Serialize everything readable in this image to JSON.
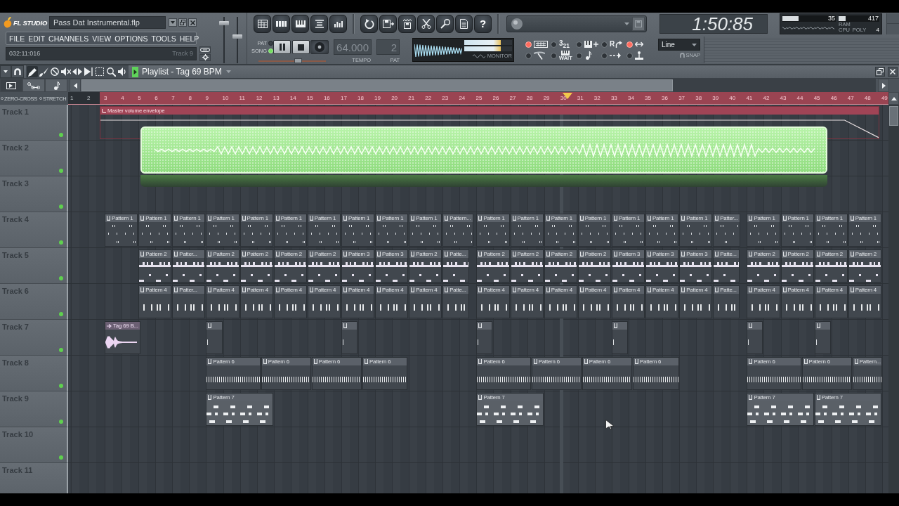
{
  "title_bar": {
    "logo": "FL STUDIO",
    "file_name": "Pass Dat Instrumental.flp"
  },
  "menu": [
    "FILE",
    "EDIT",
    "CHANNELS",
    "VIEW",
    "OPTIONS",
    "TOOLS",
    "HELP"
  ],
  "hint_bar": {
    "position": "032:11:016",
    "track": "Track 9"
  },
  "master_sliders": [
    {
      "level": 0.9
    },
    {
      "level": 0.58
    }
  ],
  "toolbar_groups": [
    [
      {
        "kind": "playlist"
      },
      {
        "kind": "step-sequencer"
      },
      {
        "kind": "piano-roll"
      },
      {
        "kind": "browser"
      },
      {
        "kind": "mixer"
      }
    ],
    [
      {
        "kind": "undo"
      },
      {
        "kind": "save-as"
      },
      {
        "kind": "export"
      },
      {
        "kind": "cut"
      },
      {
        "kind": "record"
      },
      {
        "kind": "info"
      },
      {
        "kind": "help",
        "label": "?"
      }
    ]
  ],
  "time_display": "1:50:85",
  "cpu_panel": {
    "cpu": {
      "reading": "35",
      "level": 0.3
    },
    "ram": {
      "reading": "417",
      "level": 0.18
    },
    "ram_label": "RAM",
    "cpu_label": "CPU",
    "poly_label": "POLY",
    "poly": "4"
  },
  "transport": {
    "modes": [
      {
        "label": "PAT",
        "selected": false
      },
      {
        "label": "SONG",
        "selected": true
      }
    ],
    "playing": true,
    "recording": false,
    "tempo": "64.000",
    "tempo_label": "TEMPO",
    "pattern": "2",
    "pattern_label": "PAT",
    "song_position": {
      "level": 0.6
    }
  },
  "monitor": {
    "label": "MONITOR",
    "meters": [
      {
        "level": 0.77
      },
      {
        "level": 0.77
      }
    ]
  },
  "toggles": [
    {
      "kind": "keyboard",
      "on": true
    },
    {
      "kind": "countdown",
      "label": "3$_{21}$",
      "on": false
    },
    {
      "kind": "piano-plus",
      "on": false
    },
    {
      "kind": "loop",
      "label": "R",
      "on": false
    },
    {
      "kind": "blend",
      "on": true
    },
    {
      "kind": "needle",
      "on": false
    },
    {
      "kind": "wait",
      "label": "WAIT",
      "on": false
    },
    {
      "kind": "note",
      "on": false
    },
    {
      "kind": "arrows",
      "on": false
    },
    {
      "kind": "joystick",
      "on": false
    }
  ],
  "snap": {
    "value": "Line",
    "label": "SNAP"
  },
  "playlist": {
    "title": "Playlist - Tag 69 BPM",
    "tools": [
      {
        "kind": "pencil",
        "selected": true
      },
      {
        "kind": "paint",
        "selected": false
      },
      {
        "kind": "delete",
        "selected": false
      },
      {
        "kind": "mute",
        "selected": false
      },
      {
        "kind": "slip",
        "selected": false
      },
      {
        "kind": "slice",
        "selected": false
      },
      {
        "kind": "select",
        "selected": false
      },
      {
        "kind": "zoom",
        "selected": false
      },
      {
        "kind": "playback",
        "selected": false
      }
    ],
    "view_tabs": [
      {
        "kind": "pattern",
        "selected": true
      },
      {
        "kind": "automation",
        "selected": false
      },
      {
        "kind": "note",
        "selected": false
      }
    ],
    "ruler_options": [
      {
        "label": "ZERO-CROSS",
        "on": false
      },
      {
        "label": "STRETCH",
        "on": false
      }
    ],
    "ruler": [
      "1",
      "2",
      "3",
      "4",
      "5",
      "6",
      "7",
      "8",
      "9",
      "10",
      "11",
      "12",
      "13",
      "14",
      "15",
      "16",
      "17",
      "18",
      "19",
      "20",
      "21",
      "22",
      "23",
      "24",
      "25",
      "26",
      "27",
      "28",
      "29",
      "30",
      "31",
      "32",
      "33",
      "34",
      "35",
      "36",
      "37",
      "38",
      "39",
      "40",
      "41",
      "42",
      "43",
      "44",
      "45",
      "46",
      "47",
      "48",
      "49"
    ],
    "tracks": [
      {
        "name": "Track 1",
        "muted": false,
        "clips": [
          {
            "kind": "automation",
            "label": "Master volume envelope"
          }
        ]
      },
      {
        "name": "Track 2",
        "muted": false
      },
      {
        "name": "Track 3",
        "muted": false
      },
      {
        "name": "Track 4",
        "muted": false,
        "clips": [
          {
            "label": "Pattern 1"
          },
          {
            "label": "Pattern 1"
          },
          {
            "label": "Pattern 1"
          },
          {
            "label": "Pattern 1"
          },
          {
            "label": "Pattern 1"
          },
          {
            "label": "Pattern 1"
          },
          {
            "label": "Pattern 1"
          },
          {
            "label": "Pattern 1"
          },
          {
            "label": "Pattern 1"
          },
          {
            "label": "Pattern 1"
          },
          {
            "label": "Pattern..."
          },
          {
            "label": "Pattern 1"
          },
          {
            "label": "Pattern 1"
          },
          {
            "label": "Pattern 1"
          },
          {
            "label": "Pattern 1"
          },
          {
            "label": "Pattern 1"
          },
          {
            "label": "Pattern 1"
          },
          {
            "label": "Pattern 1"
          },
          {
            "label": "Patter..."
          },
          {
            "label": "Pattern 1"
          },
          {
            "label": "Pattern 1"
          },
          {
            "label": "Pattern 1"
          },
          {
            "label": "Pattern 1"
          }
        ]
      },
      {
        "name": "Track 5",
        "muted": false,
        "clips": [
          {
            "label": "Pattern 2"
          },
          {
            "label": "Patter..."
          },
          {
            "label": "Pattern 2"
          },
          {
            "label": "Pattern 2"
          },
          {
            "label": "Pattern 2"
          },
          {
            "label": "Pattern 2"
          },
          {
            "label": "Pattern 3"
          },
          {
            "label": "Pattern 3"
          },
          {
            "label": "Pattern 2"
          },
          {
            "label": "Patte..."
          },
          {
            "label": "Pattern 2"
          },
          {
            "label": "Pattern 2"
          },
          {
            "label": "Pattern 2"
          },
          {
            "label": "Pattern 2"
          },
          {
            "label": "Pattern 3"
          },
          {
            "label": "Pattern 3"
          },
          {
            "label": "Pattern 3"
          },
          {
            "label": "Patte..."
          },
          {
            "label": "Pattern 2"
          },
          {
            "label": "Pattern 2"
          },
          {
            "label": "Pattern 2"
          },
          {
            "label": "Pattern 2"
          }
        ]
      },
      {
        "name": "Track 6",
        "muted": false,
        "clips": [
          {
            "label": "Pattern 4"
          },
          {
            "label": "Patter..."
          },
          {
            "label": "Pattern 4"
          },
          {
            "label": "Pattern 4"
          },
          {
            "label": "Pattern 4"
          },
          {
            "label": "Pattern 4"
          },
          {
            "label": "Pattern 4"
          },
          {
            "label": "Pattern 4"
          },
          {
            "label": "Pattern 4"
          },
          {
            "label": "Patte..."
          },
          {
            "label": "Pattern 4"
          },
          {
            "label": "Pattern 4"
          },
          {
            "label": "Pattern 4"
          },
          {
            "label": "Pattern 4"
          },
          {
            "label": "Pattern 4"
          },
          {
            "label": "Pattern 4"
          },
          {
            "label": "Pattern 4"
          },
          {
            "label": "Patte..."
          },
          {
            "label": "Pattern 4"
          },
          {
            "label": "Pattern 4"
          },
          {
            "label": "Pattern 4"
          },
          {
            "label": "Pattern 4"
          }
        ]
      },
      {
        "name": "Track 7",
        "muted": false,
        "clips": [
          {
            "kind": "audio",
            "label": "Tag 69 B..."
          },
          {
            "kind": "pattern"
          },
          {
            "kind": "pattern"
          },
          {
            "kind": "pattern"
          },
          {
            "kind": "pattern"
          },
          {
            "kind": "pattern"
          },
          {
            "kind": "pattern"
          }
        ]
      },
      {
        "name": "Track 8",
        "muted": false,
        "clips": [
          {
            "label": "Pattern 6"
          },
          {
            "label": "Pattern 6"
          },
          {
            "label": "Pattern 6"
          },
          {
            "label": "Pattern 6"
          },
          {
            "label": "Pattern 6"
          },
          {
            "label": "Pattern 6"
          },
          {
            "label": "Pattern 6"
          },
          {
            "label": "Pattern 6"
          },
          {
            "label": "Pattern 6"
          },
          {
            "label": "Pattern 6"
          },
          {
            "label": "Pattern..."
          }
        ]
      },
      {
        "name": "Track 9",
        "muted": false,
        "clips": [
          {
            "label": "Pattern 7"
          },
          {
            "label": "Pattern 7"
          },
          {
            "label": "Pattern 7"
          },
          {
            "label": "Pattern 7"
          }
        ]
      },
      {
        "name": "Track 10",
        "muted": false
      },
      {
        "name": "Track 11"
      }
    ]
  }
}
